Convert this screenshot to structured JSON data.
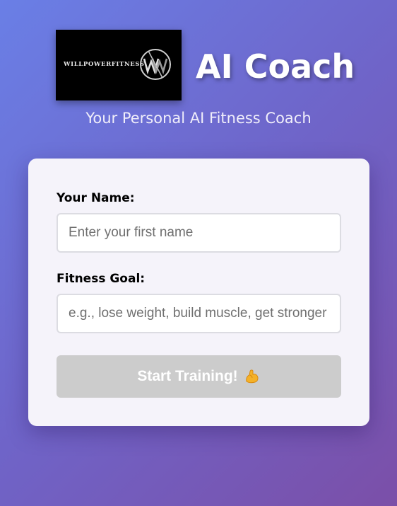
{
  "header": {
    "logo_text": "WILLPOWERFITNESS",
    "title": "AI Coach",
    "subtitle": "Your Personal AI Fitness Coach"
  },
  "form": {
    "name_label": "Your Name:",
    "name_placeholder": "Enter your first name",
    "name_value": "",
    "goal_label": "Fitness Goal:",
    "goal_placeholder": "e.g., lose weight, build muscle, get stronger",
    "goal_value": "",
    "submit_label": "Start Training!",
    "submit_icon": "flexed-bicep-icon",
    "submit_enabled": false
  },
  "colors": {
    "background_start": "#6a7fe6",
    "background_end": "#7b4fa8",
    "card": "#f5f3fa",
    "button_disabled": "#cccccc"
  }
}
